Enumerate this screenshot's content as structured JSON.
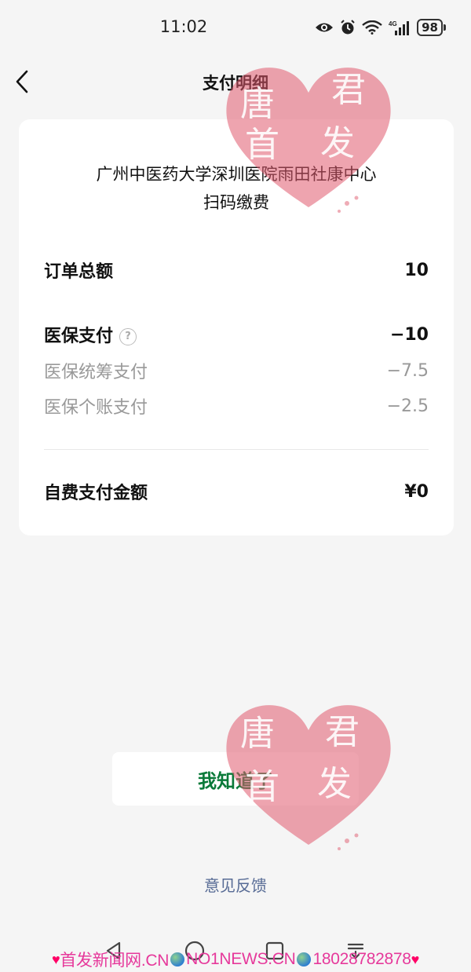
{
  "status_bar": {
    "time": "11:02",
    "network": "4G",
    "battery": "98"
  },
  "header": {
    "title": "支付明细"
  },
  "card": {
    "merchant_line1": "广州中医药大学深圳医院雨田社康中心",
    "merchant_line2": "扫码缴费",
    "order_total_label": "订单总额",
    "order_total_value": "10",
    "insurance_label": "医保支付",
    "insurance_value": "−10",
    "pooled_label": "医保统筹支付",
    "pooled_value": "−7.5",
    "personal_label": "医保个账支付",
    "personal_value": "−2.5",
    "self_pay_label": "自费支付金额",
    "self_pay_value": "¥0"
  },
  "actions": {
    "ok_label": "我知道了",
    "feedback_label": "意见反馈"
  },
  "watermark": {
    "chars": [
      "唐",
      "君",
      "首",
      "发"
    ],
    "footer": "首发新闻网.CN",
    "footer2": "NO1NEWS.CN",
    "footer3": "18028782878"
  },
  "colors": {
    "accent_green": "#0b7a3a",
    "link_blue": "#576b95",
    "watermark_pink": "#e05a6e"
  }
}
